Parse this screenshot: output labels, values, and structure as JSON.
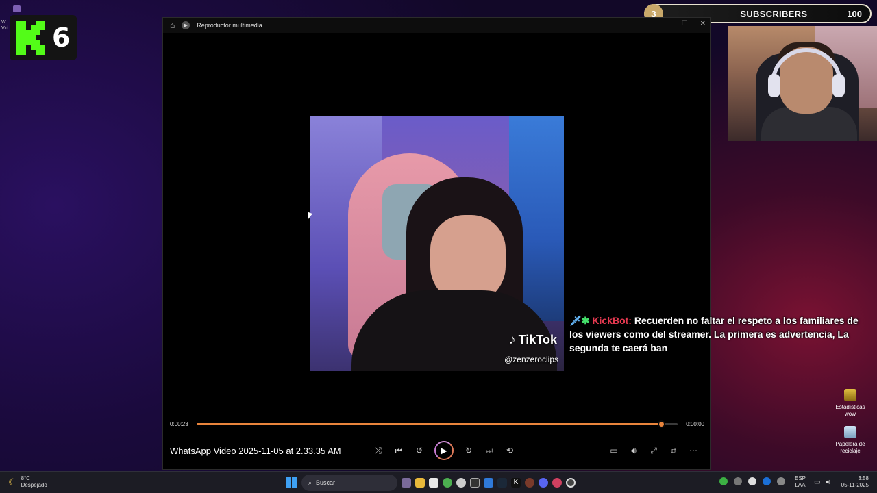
{
  "desktop": {
    "fragment_lines": [
      "W",
      "Vid"
    ],
    "icons": [
      {
        "label_lines": [
          "Estadísticas",
          "wow"
        ],
        "icon": "spreadsheet-icon"
      },
      {
        "label_lines": [
          "Papelera de",
          "reciclaje"
        ],
        "icon": "recycle-bin-icon"
      }
    ]
  },
  "overlay": {
    "kick_number": "6",
    "subscribers": {
      "current": "3",
      "label": "SUBSCRIBERS",
      "goal": "100",
      "colors": {
        "count_bg": "#c9a86a",
        "border": "#e8e2d0"
      }
    },
    "chat": {
      "user": "KickBot:",
      "message": "Recuerden no faltar el respeto a los familiares de los viewers como del streamer. La primera es advertencia, La segunda te caerá ban",
      "badges": [
        "sword-badge-icon",
        "star-badge-icon"
      ],
      "colors": {
        "user": "#e53950"
      }
    }
  },
  "player": {
    "app_title": "Reproductor multimedia",
    "video": {
      "watermark_brand": "TikTok",
      "watermark_handle": "@zenzeroclips"
    },
    "progress": {
      "elapsed": "0:00:23",
      "remaining": "0:00:00",
      "fraction": 0.965,
      "accent": "#e8843c"
    },
    "file_title": "WhatsApp Video 2025-11-05 at 2.33.35 AM",
    "controls": [
      "shuffle-icon",
      "previous-icon",
      "rewind-10-icon",
      "play-icon",
      "forward-30-icon",
      "next-icon",
      "repeat-icon"
    ],
    "right_controls": [
      "captions-icon",
      "volume-icon",
      "fullscreen-icon",
      "miniplayer-icon",
      "more-icon"
    ]
  },
  "taskbar": {
    "weather": {
      "temp": "8°C",
      "condition": "Despejado"
    },
    "search_placeholder": "Buscar",
    "lang": [
      "ESP",
      "LAA"
    ],
    "time": "3:58",
    "date": "05-11-2025"
  }
}
